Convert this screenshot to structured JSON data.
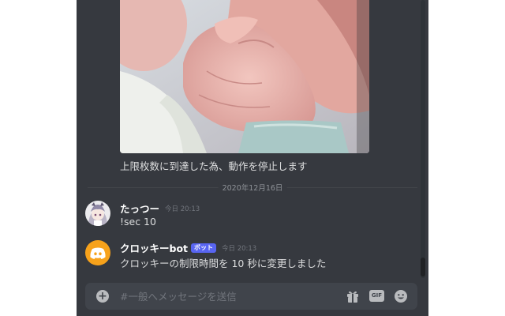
{
  "attachment": {
    "alt": "baby hand holding a finger"
  },
  "bot_previous_message": {
    "text": "上限枚数に到達した為、動作を停止します"
  },
  "divider": {
    "date": "2020年12月16日"
  },
  "messages": [
    {
      "author": "たっつー",
      "time": "今日 20:13",
      "text": "!sec 10",
      "avatar": "anime-character-avatar",
      "is_bot": false
    },
    {
      "author": "クロッキーbot",
      "bot_tag": "ボット",
      "time": "今日 20:13",
      "text": "クロッキーの制限時間を 10 秒に変更しました",
      "avatar": "discord-logo-avatar",
      "is_bot": true
    }
  ],
  "composer": {
    "placeholder": "#一般へメッセージを送信",
    "gif_label": "GIF",
    "icons": [
      "plus-icon",
      "gift-icon",
      "gif-icon",
      "emoji-icon"
    ]
  },
  "colors": {
    "background": "#36393f",
    "composer": "#40444b",
    "bot_tag": "#5865f2",
    "discord_avatar": "#f7a21b"
  }
}
